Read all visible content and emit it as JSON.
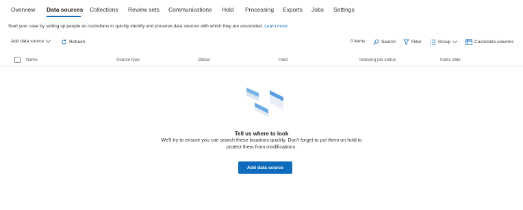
{
  "tabs": [
    {
      "label": "Overview",
      "active": false
    },
    {
      "label": "Data sources",
      "active": true
    },
    {
      "label": "Collections",
      "active": false
    },
    {
      "label": "Review sets",
      "active": false
    },
    {
      "label": "Communications",
      "active": false
    },
    {
      "label": "Hold",
      "active": false
    },
    {
      "label": "Processing",
      "active": false
    },
    {
      "label": "Exports",
      "active": false
    },
    {
      "label": "Jobs",
      "active": false
    },
    {
      "label": "Settings",
      "active": false
    }
  ],
  "intro": {
    "text": "Start your case by setting up people as custodians to quickly identify and preserve data sources with which they are associated.",
    "link": "Learn more"
  },
  "toolbar": {
    "add_label": "Add data source",
    "refresh_label": "Refresh",
    "count_label": "0 items",
    "search_label": "Search",
    "filter_label": "Filter",
    "group_label": "Group",
    "customize_label": "Customize columns"
  },
  "columns": [
    "Name",
    "Source type",
    "Status",
    "Hold",
    "Indexing job status",
    "Index date"
  ],
  "empty_state": {
    "title": "Tell us where to look",
    "description": "We'll try to ensure you can search these locations quickly. Don't forget to put them on hold to protect them from modifications.",
    "button_label": "Add data source"
  },
  "colors": {
    "accent": "#0f6cbd",
    "text": "#323130",
    "muted": "#605e5c",
    "divider": "#e1dfdd"
  }
}
